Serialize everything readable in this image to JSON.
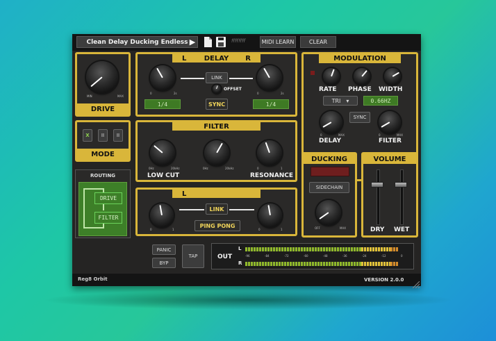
{
  "topbar": {
    "preset_name": "Clean Delay Ducking Endless",
    "midi_learn": "MIDI LEARN",
    "clear": "CLEAR",
    "extra_label": "ffffffff"
  },
  "drive": {
    "title": "DRIVE",
    "min": "MIN",
    "max": "MAX"
  },
  "mode": {
    "title": "MODE",
    "options": [
      "X",
      "II",
      "II"
    ]
  },
  "routing": {
    "title": "ROUTING",
    "box1": "DRIVE",
    "box2": "FILTER"
  },
  "delay": {
    "title_l": "L",
    "title": "DELAY",
    "title_r": "R",
    "link": "LINK",
    "offset": "OFFSET",
    "sync": "SYNC",
    "left_value": "1/4",
    "right_value": "1/4",
    "knob_min": "0",
    "knob_max": "2s"
  },
  "filter": {
    "title": "FILTER",
    "low_cut": "LOW CUT",
    "high_cut": "RESONANCE",
    "lc_min": "0Hz",
    "lc_max": "20kHz",
    "hc_min": "0Hz",
    "hc_max": "20kHz",
    "r_min": "0",
    "r_max": "1"
  },
  "feedback": {
    "title": "L",
    "link": "LINK",
    "ping_pong": "PING PONG",
    "min": "0",
    "max": "1"
  },
  "modulation": {
    "title": "MODULATION",
    "rate": "RATE",
    "phase": "PHASE",
    "width": "WIDTH",
    "shape": "TRI",
    "frequency": "0.66HZ",
    "sync": "SYNC",
    "delay": "DELAY",
    "filter": "FILTER",
    "min": "0",
    "max": "MAX"
  },
  "ducking": {
    "title": "DUCKING",
    "sidechain": "SIDECHAIN",
    "off": "OFF",
    "max": "MAX"
  },
  "volume": {
    "title": "VOLUME",
    "dry": "DRY",
    "wet": "WET",
    "dry_level": 0.72,
    "wet_level": 0.72
  },
  "bottom": {
    "panic": "PANIC",
    "byp": "BYP",
    "tap": "TAP",
    "out": "OUT",
    "ch_l": "L",
    "ch_r": "R",
    "scale": [
      "-96",
      "-84",
      "-72",
      "-60",
      "-48",
      "-36",
      "-24",
      "-12",
      "0"
    ],
    "level_l": 0.95,
    "level_r": 0.95
  },
  "footer": {
    "brand": "Reg8 Orbit",
    "version": "VERSION 2.0.0"
  },
  "colors": {
    "accent": "#d9b63a",
    "panel_bg": "#252423",
    "green": "#3e7a24"
  }
}
